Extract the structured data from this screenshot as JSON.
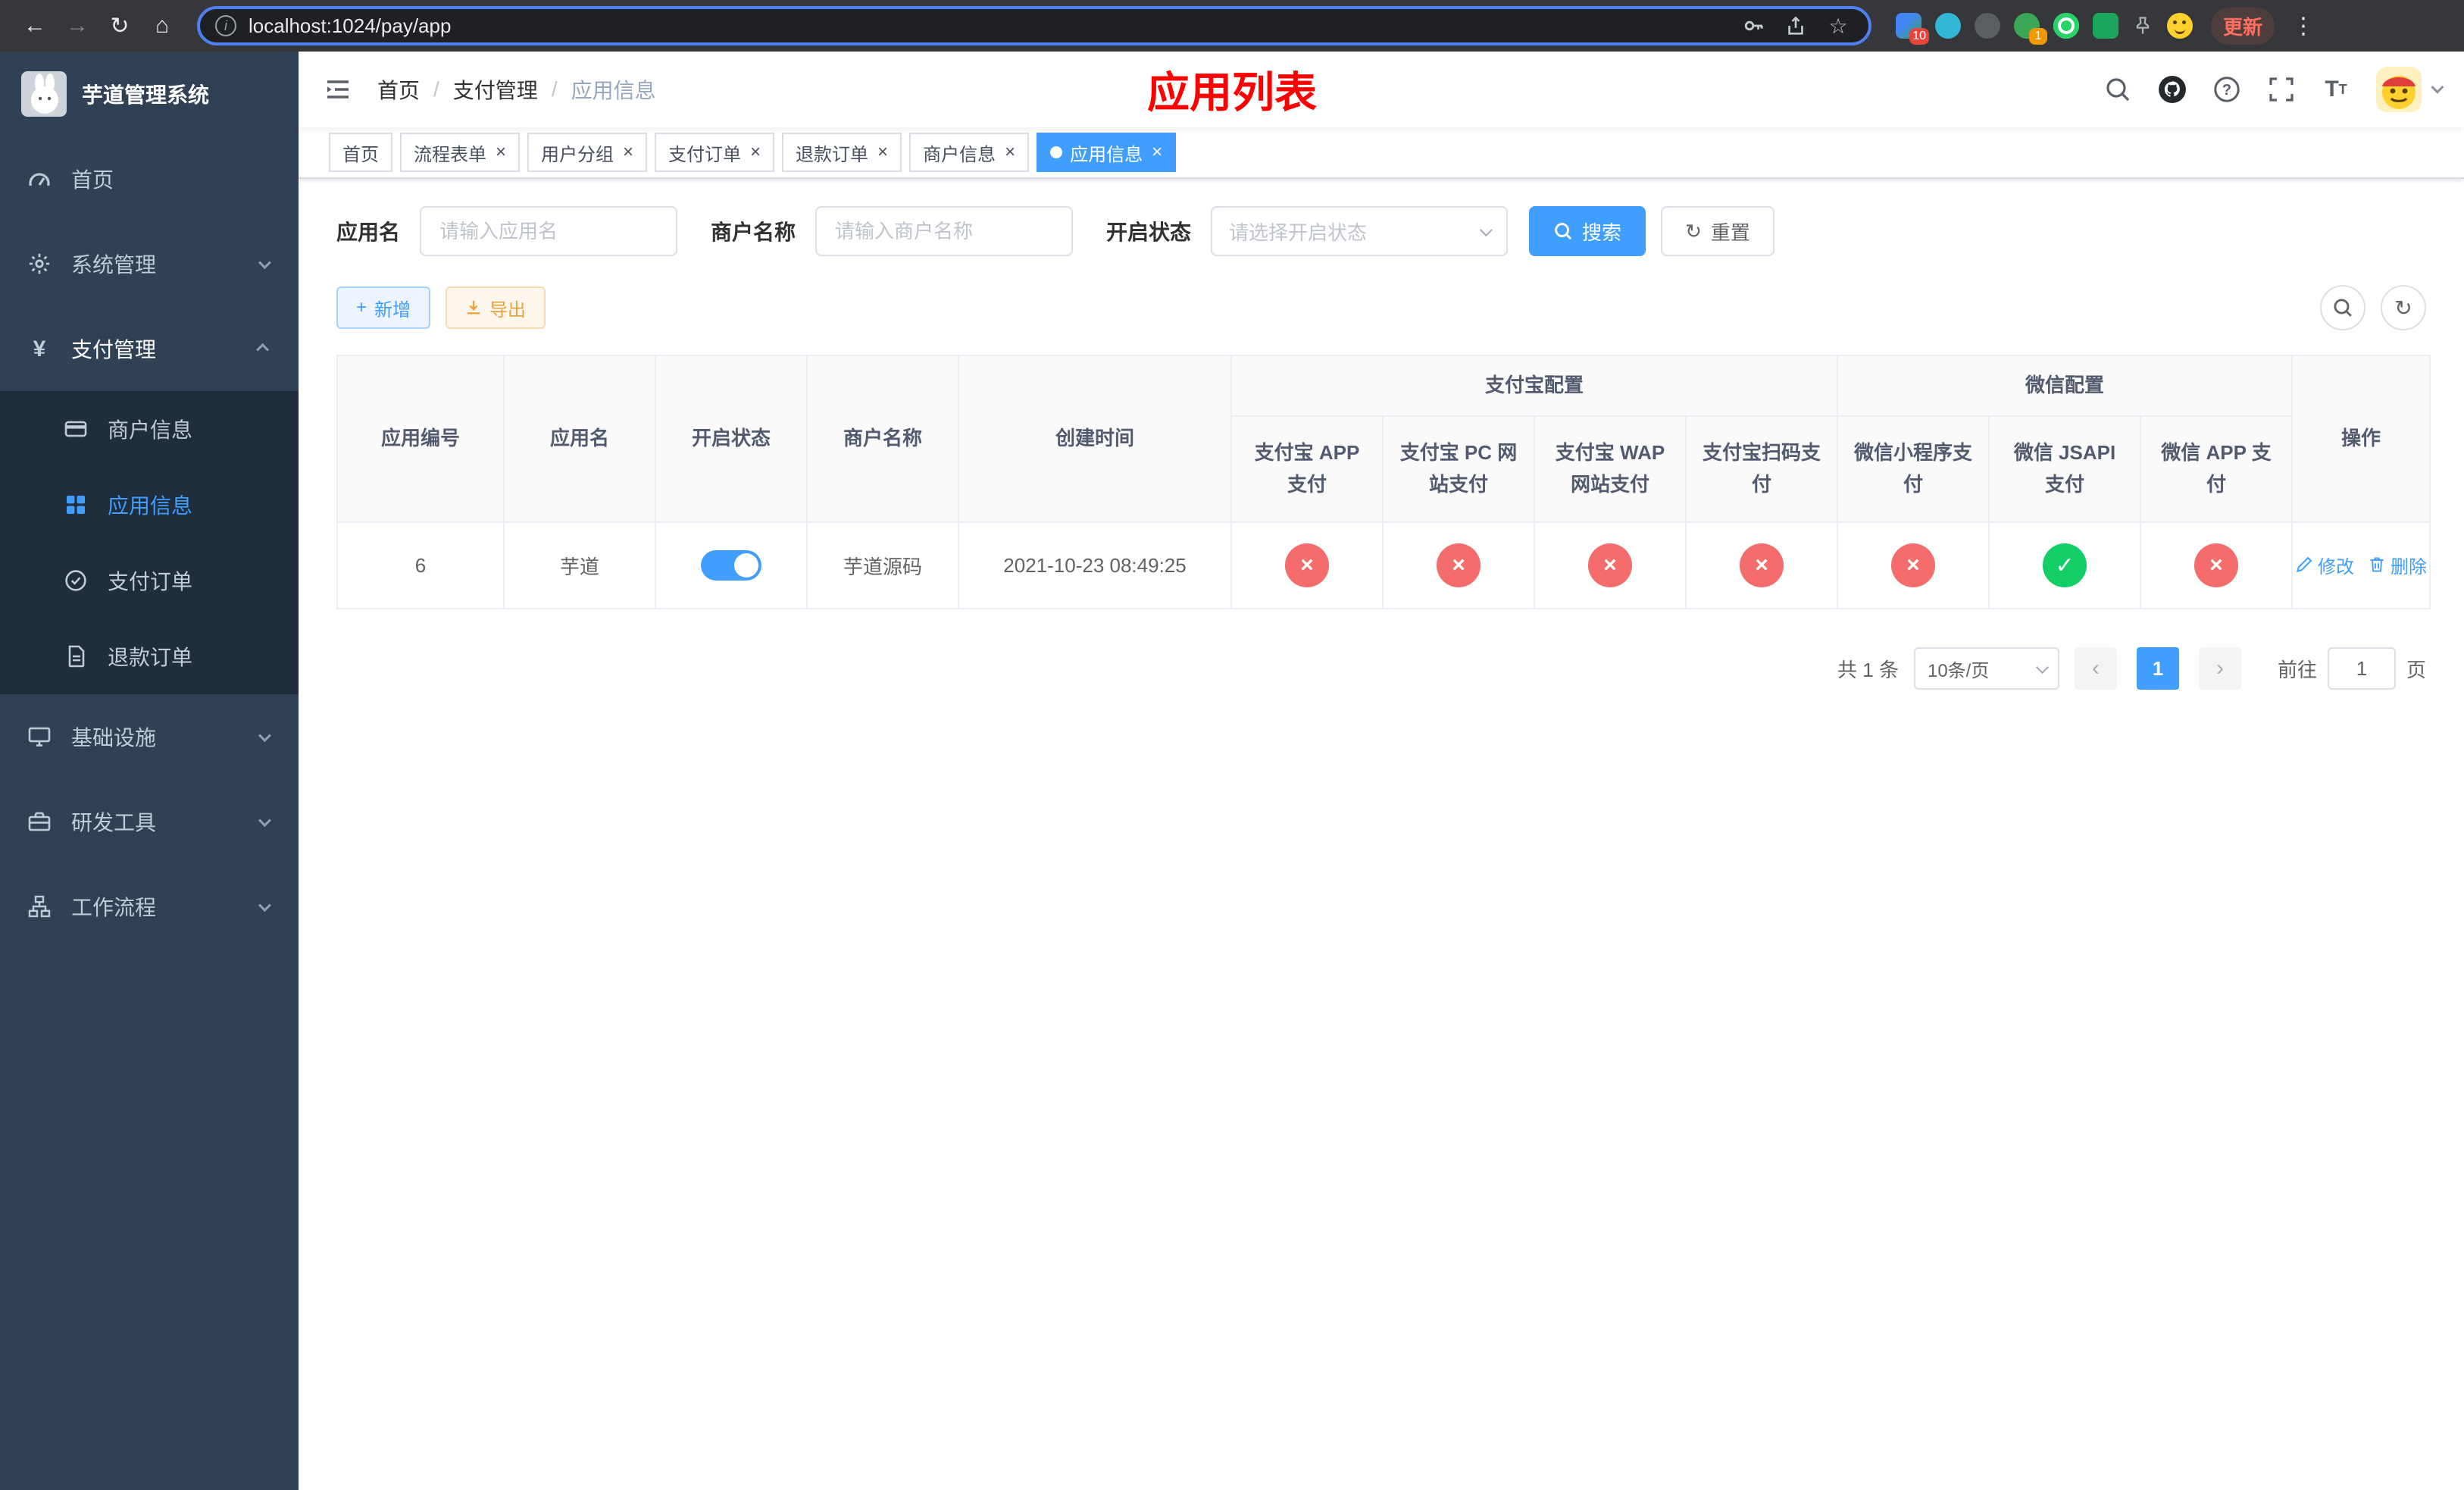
{
  "browser": {
    "url": "localhost:1024/pay/app",
    "update_button": "更新",
    "notification_badge": "10",
    "extension_badge": "1"
  },
  "icons": {
    "back": "←",
    "forward": "→",
    "reload": "↻",
    "home": "⌂",
    "info": "i",
    "star": "☆",
    "menu_dots": "⋮",
    "check": "✓",
    "cross": "×",
    "plus": "+",
    "refresh": "↻",
    "prev": "‹",
    "next": "›"
  },
  "colors": {
    "accent": "#409eff",
    "danger": "#f56c6c",
    "success": "#13ce66",
    "warning": "#e6a23c",
    "title_red": "#fe0000",
    "sidebar_bg": "#304156",
    "submenu_bg": "#1f2d3d"
  },
  "app": {
    "title": "芋道管理系统"
  },
  "sidebar": {
    "items": [
      {
        "label": "首页"
      },
      {
        "label": "系统管理"
      },
      {
        "label": "支付管理"
      },
      {
        "label": "基础设施"
      },
      {
        "label": "研发工具"
      },
      {
        "label": "工作流程"
      }
    ],
    "payment_children": [
      {
        "label": "商户信息"
      },
      {
        "label": "应用信息"
      },
      {
        "label": "支付订单"
      },
      {
        "label": "退款订单"
      }
    ]
  },
  "header": {
    "breadcrumb": [
      "首页",
      "支付管理",
      "应用信息"
    ],
    "title": "应用列表"
  },
  "tabs": [
    {
      "label": "首页"
    },
    {
      "label": "流程表单"
    },
    {
      "label": "用户分组"
    },
    {
      "label": "支付订单"
    },
    {
      "label": "退款订单"
    },
    {
      "label": "商户信息"
    },
    {
      "label": "应用信息"
    }
  ],
  "filters": {
    "app_name_label": "应用名",
    "app_name_placeholder": "请输入应用名",
    "merchant_label": "商户名称",
    "merchant_placeholder": "请输入商户名称",
    "status_label": "开启状态",
    "status_placeholder": "请选择开启状态",
    "search_button": "搜索",
    "reset_button": "重置"
  },
  "toolbar": {
    "add_button": "新增",
    "export_button": "导出"
  },
  "table": {
    "groups": {
      "alipay": "支付宝配置",
      "wechat": "微信配置"
    },
    "columns": {
      "app_id": "应用编号",
      "app_name": "应用名",
      "status": "开启状态",
      "merchant_name": "商户名称",
      "create_time": "创建时间",
      "alipay_app": "支付宝 APP 支付",
      "alipay_pc": "支付宝 PC 网站支付",
      "alipay_wap": "支付宝 WAP 网站支付",
      "alipay_qr": "支付宝扫码支付",
      "wx_lite": "微信小程序支付",
      "wx_jsapi": "微信 JSAPI 支付",
      "wx_app": "微信 APP 支付",
      "actions": "操作"
    },
    "rows": [
      {
        "app_id": "6",
        "app_name": "芋道",
        "status_enabled": true,
        "merchant_name": "芋道源码",
        "create_time": "2021-10-23 08:49:25",
        "alipay_app": "disabled",
        "alipay_pc": "disabled",
        "alipay_wap": "disabled",
        "alipay_qr": "disabled",
        "wx_lite": "disabled",
        "wx_jsapi": "enabled",
        "wx_app": "disabled",
        "edit_label": "修改",
        "delete_label": "删除"
      }
    ]
  },
  "pagination": {
    "total": "共 1 条",
    "page_size": "10条/页",
    "current_page": "1",
    "goto_prefix": "前往",
    "goto_value": "1",
    "goto_suffix": "页"
  }
}
